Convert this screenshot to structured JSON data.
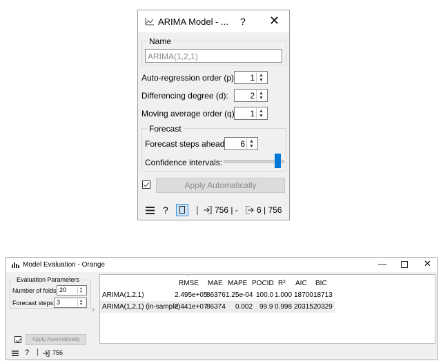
{
  "arima": {
    "title": "ARIMA Model - ...",
    "help_glyph": "?",
    "close_glyph": "✕",
    "name_group_label": "Name",
    "name_value": "ARIMA(1,2,1)",
    "params": [
      {
        "label": "Auto-regression order (p):",
        "value": "1"
      },
      {
        "label": "Differencing degree (d):",
        "value": "2"
      },
      {
        "label": "Moving average order (q):",
        "value": "1"
      }
    ],
    "forecast_group_label": "Forecast",
    "forecast_steps_label": "Forecast steps ahead:",
    "forecast_steps_value": "6",
    "confidence_label": "Confidence intervals:",
    "confidence_level": 1.0,
    "apply_label": "Apply Automatically",
    "apply_checked": true,
    "status": {
      "input_count": "756 | -",
      "output_count": "6 | 756"
    }
  },
  "evaluation": {
    "title": "Model Evaluation - Orange",
    "params_group_label": "Evaluation Parameters",
    "folds_label": "Number of folds:",
    "folds_value": "20",
    "steps_label": "Forecast steps:",
    "steps_value": "3",
    "apply_label": "Apply Automatically",
    "apply_checked": true,
    "status": {
      "input_count": "756"
    },
    "table": {
      "columns": [
        "RMSE",
        "MAE",
        "MAPE",
        "POCID",
        "R²",
        "AIC",
        "BIC"
      ],
      "rows": [
        {
          "model": "ARIMA(1,2,1)",
          "values": [
            "2.495e+05",
            "86376",
            "1.25e-04",
            "100.0",
            "1.000",
            "18700",
            "18713"
          ]
        },
        {
          "model": "ARIMA(1,2,1) (in-sample)",
          "values": [
            "2.441e+07",
            "86374",
            "0.002",
            "99.9",
            "0.998",
            "20315",
            "20329"
          ]
        }
      ]
    }
  }
}
